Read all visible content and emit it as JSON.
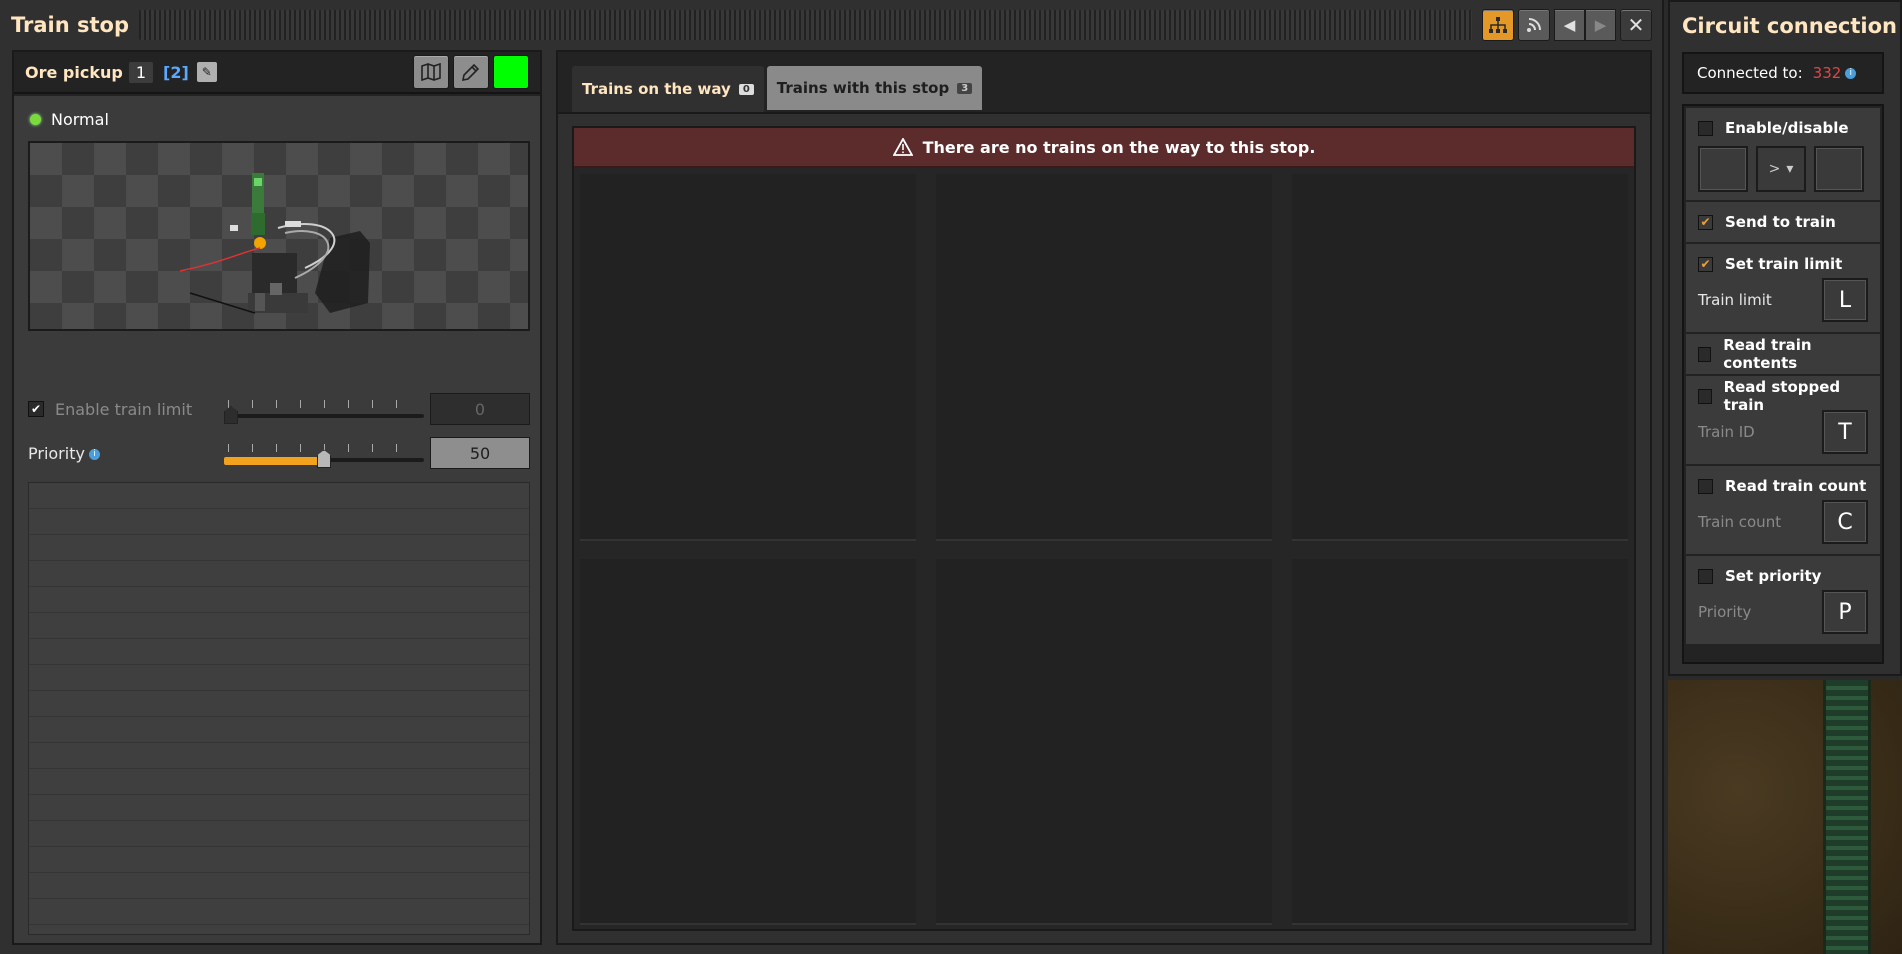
{
  "window": {
    "title": "Train stop"
  },
  "stop": {
    "name": "Ore pickup",
    "count": "1",
    "limit_display": "[2]",
    "status": "Normal",
    "color": "#00ff00"
  },
  "settings": {
    "enable_limit_label": "Enable train limit",
    "limit_value": "0",
    "priority_label": "Priority",
    "priority_value": "50",
    "priority_fraction": 0.5
  },
  "tabs": [
    {
      "label": "Trains on the way",
      "badge": "0"
    },
    {
      "label": "Trains with this stop",
      "badge": "3"
    }
  ],
  "trains": {
    "empty_message": "There are no trains on the way to this stop."
  },
  "circuit": {
    "title": "Circuit connection",
    "connected_label": "Connected to:",
    "connected_value": "332",
    "enable_disable": "Enable/disable",
    "operator": ">",
    "send_to_train": "Send to train",
    "set_train_limit": "Set train limit",
    "train_limit_label": "Train limit",
    "train_limit_signal": "L",
    "read_contents": "Read train contents",
    "read_stopped": "Read stopped train",
    "train_id_label": "Train ID",
    "train_id_signal": "T",
    "read_count": "Read train count",
    "train_count_label": "Train count",
    "train_count_signal": "C",
    "set_priority": "Set priority",
    "priority_label": "Priority",
    "priority_signal": "P"
  },
  "colors": {
    "accent": "#e39827",
    "warning_banner": "#5c2b2b",
    "connected_red": "#e04545"
  }
}
